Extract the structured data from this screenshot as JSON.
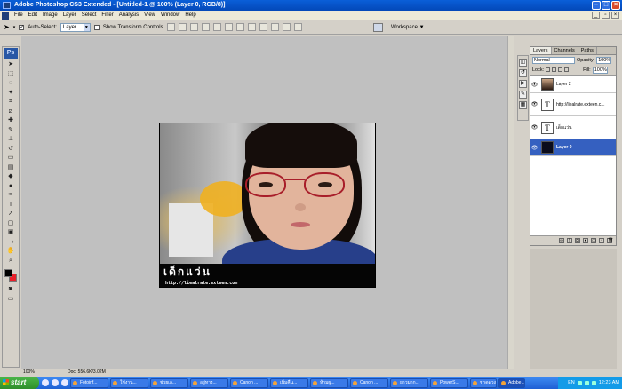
{
  "window": {
    "title": "Adobe Photoshop CS3 Extended - [Untitled-1 @ 100% (Layer 0, RGB/8)]"
  },
  "menu": [
    "File",
    "Edit",
    "Image",
    "Layer",
    "Select",
    "Filter",
    "Analysis",
    "View",
    "Window",
    "Help"
  ],
  "options": {
    "auto_select_label": "Auto-Select:",
    "auto_select_value": "Layer",
    "transform_label": "Show Transform Controls",
    "workspace_label": "Workspace ▼"
  },
  "toolbox": {
    "logo": "Ps"
  },
  "canvas": {
    "caption_thai": "เด็กแว่น",
    "caption_url": "http://liealrate.exteen.com"
  },
  "status": {
    "zoom": "100%",
    "doc": "Doc: 556.6K/3.02M"
  },
  "layers_panel": {
    "tabs": [
      "Layers",
      "Channels",
      "Paths"
    ],
    "blend_mode": "Normal",
    "opacity_label": "Opacity:",
    "opacity_value": "100%",
    "lock_label": "Lock:",
    "fill_label": "Fill:",
    "fill_value": "100%",
    "layers": [
      {
        "name": "Layer 2",
        "thumb": ""
      },
      {
        "name": "http://liealrate.exteen.c...",
        "thumb": "T"
      },
      {
        "name": "เด็กแว่น",
        "thumb": "T"
      },
      {
        "name": "Layer 0",
        "thumb": ""
      }
    ]
  },
  "taskbar": {
    "start": "start",
    "tasks": [
      "Fotoinf...",
      "ใช้งาน...",
      "ช่วยเล...",
      "อยู่ทาง...",
      "Canon ...",
      "เพิ่มคืน...",
      "ห้ามผู...",
      "Canon ...",
      "ยาวมาก...",
      "PowerS...",
      "ขาดดวง...",
      "Adobe ..."
    ],
    "lang": "EN",
    "clock": "12:23 AM"
  }
}
